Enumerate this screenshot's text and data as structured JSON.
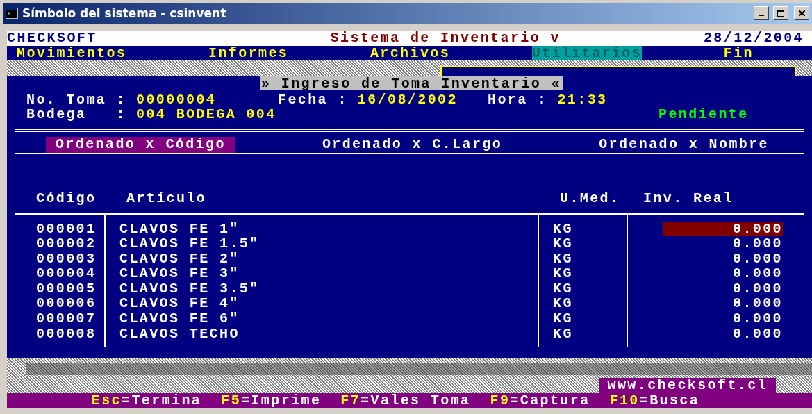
{
  "window": {
    "title": "Símbolo del sistema - csinvent"
  },
  "header": {
    "company": "CHECKSOFT",
    "system": "Sistema de Inventario v",
    "date": "28/12/2004"
  },
  "menu": [
    {
      "label": "Movimientos",
      "selected": false
    },
    {
      "label": "Informes",
      "selected": false
    },
    {
      "label": "Archivos",
      "selected": false
    },
    {
      "label": "Utilitarios",
      "selected": true
    },
    {
      "label": "Fin",
      "selected": false
    }
  ],
  "dialog": {
    "title": "» Ingreso de Toma Inventario «",
    "fields": [
      {
        "label": "No. Toma :",
        "value": "00000004"
      },
      {
        "label": "Fecha :",
        "value": "16/08/2002"
      },
      {
        "label": "Hora :",
        "value": "21:33"
      },
      {
        "label": "Bodega   :",
        "value": "004 BODEGA 004"
      }
    ],
    "status": "Pendiente"
  },
  "sort_options": [
    {
      "label": "Ordenado x Código",
      "selected": true
    },
    {
      "label": "Ordenado x C.Largo",
      "selected": false
    },
    {
      "label": "Ordenado x Nombre",
      "selected": false
    }
  ],
  "table": {
    "columns": [
      "Código",
      "Artículo",
      "U.Med.",
      "Inv. Real"
    ],
    "rows": [
      {
        "code": "000001",
        "article": "CLAVOS FE 1\"",
        "unit": "KG",
        "inv_real": "0.000",
        "selected": true
      },
      {
        "code": "000002",
        "article": "CLAVOS FE 1.5\"",
        "unit": "KG",
        "inv_real": "0.000",
        "selected": false
      },
      {
        "code": "000003",
        "article": "CLAVOS FE 2\"",
        "unit": "KG",
        "inv_real": "0.000",
        "selected": false
      },
      {
        "code": "000004",
        "article": "CLAVOS FE 3\"",
        "unit": "KG",
        "inv_real": "0.000",
        "selected": false
      },
      {
        "code": "000005",
        "article": "CLAVOS FE 3.5\"",
        "unit": "KG",
        "inv_real": "0.000",
        "selected": false
      },
      {
        "code": "000006",
        "article": "CLAVOS FE 4\"",
        "unit": "KG",
        "inv_real": "0.000",
        "selected": false
      },
      {
        "code": "000007",
        "article": "CLAVOS FE 6\"",
        "unit": "KG",
        "inv_real": "0.000",
        "selected": false
      },
      {
        "code": "000008",
        "article": "CLAVOS TECHO",
        "unit": "KG",
        "inv_real": "0.000",
        "selected": false
      }
    ]
  },
  "website": "www.checksoft.cl",
  "function_keys": [
    {
      "key": "Esc",
      "action": "=Termina"
    },
    {
      "key": "F5",
      "action": "=Imprime"
    },
    {
      "key": "F7",
      "action": "=Vales Toma"
    },
    {
      "key": "F9",
      "action": "=Captura"
    },
    {
      "key": "F10",
      "action": "=Busca"
    }
  ]
}
